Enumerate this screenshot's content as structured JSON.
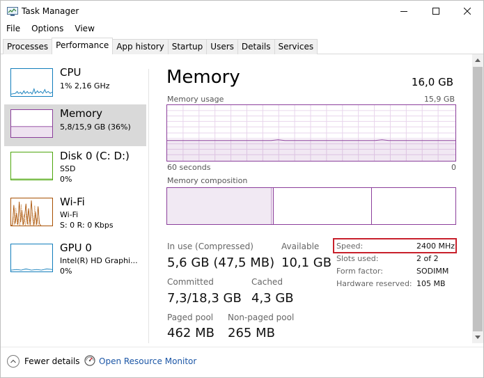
{
  "window": {
    "title": "Task Manager"
  },
  "menu": [
    "File",
    "Options",
    "View"
  ],
  "tabs": [
    "Processes",
    "Performance",
    "App history",
    "Startup",
    "Users",
    "Details",
    "Services"
  ],
  "sidebar": {
    "cpu": {
      "name": "CPU",
      "sub": "1% 2,16 GHz"
    },
    "memory": {
      "name": "Memory",
      "sub": "5,8/15,9 GB (36%)"
    },
    "disk": {
      "name": "Disk 0 (C: D:)",
      "sub1": "SSD",
      "sub2": "0%"
    },
    "wifi": {
      "name": "Wi-Fi",
      "sub1": "Wi-Fi",
      "sub2": "S: 0 R: 0 Kbps"
    },
    "gpu": {
      "name": "GPU 0",
      "sub1": "Intel(R) HD Graphi...",
      "sub2": "0%"
    }
  },
  "main": {
    "title": "Memory",
    "total": "16,0 GB",
    "usage_label": "Memory usage",
    "usage_max": "15,9 GB",
    "time_left": "60 seconds",
    "time_right": "0",
    "composition_label": "Memory composition",
    "composition": {
      "in_use": 36,
      "modified": 1,
      "standby": 34,
      "free": 29
    },
    "stats": {
      "in_use_label": "In use (Compressed)",
      "in_use_value": "5,6 GB (47,5 MB)",
      "available_label": "Available",
      "available_value": "10,1 GB",
      "committed_label": "Committed",
      "committed_value": "7,3/18,3 GB",
      "cached_label": "Cached",
      "cached_value": "4,3 GB",
      "paged_label": "Paged pool",
      "paged_value": "462 MB",
      "nonpaged_label": "Non-paged pool",
      "nonpaged_value": "265 MB"
    },
    "details": {
      "speed_label": "Speed:",
      "speed_value": "2400 MHz",
      "slots_label": "Slots used:",
      "slots_value": "2 of 2",
      "form_label": "Form factor:",
      "form_value": "SODIMM",
      "reserved_label": "Hardware reserved:",
      "reserved_value": "105 MB"
    }
  },
  "footer": {
    "fewer_details": "Fewer details",
    "open_monitor": "Open Resource Monitor"
  },
  "colors": {
    "memory": "#8b3e9b",
    "cpu": "#117dbb",
    "disk": "#4da60c",
    "wifi": "#a74f01",
    "highlight": "#c8202b"
  }
}
